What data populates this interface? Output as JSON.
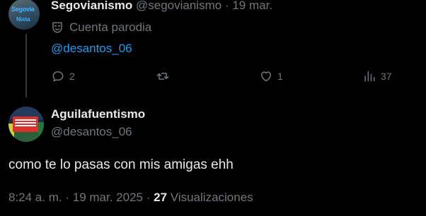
{
  "parent_tweet": {
    "avatar_text_line1": "Segovia",
    "avatar_text_line2": "Nista",
    "display_name": "Segovianismo",
    "handle": "@segovianismo",
    "separator": "·",
    "date": "19 mar.",
    "parody_label": "Cuenta parodia",
    "mention": "@desantos_06",
    "actions": {
      "replies": "2",
      "reposts": "",
      "likes": "1",
      "views": "37"
    }
  },
  "reply_tweet": {
    "display_name": "Aguilafuentismo",
    "handle": "@desantos_06",
    "text": "como te lo pasas con mis amigas ehh",
    "time": "8:24 a. m.",
    "separator": "·",
    "date": "19 mar. 2025",
    "views_count": "27",
    "views_label": "Visualizaciones"
  },
  "colors": {
    "background": "#000000",
    "text": "#e7e9ea",
    "muted": "#71767b",
    "link": "#1d9bf0"
  }
}
